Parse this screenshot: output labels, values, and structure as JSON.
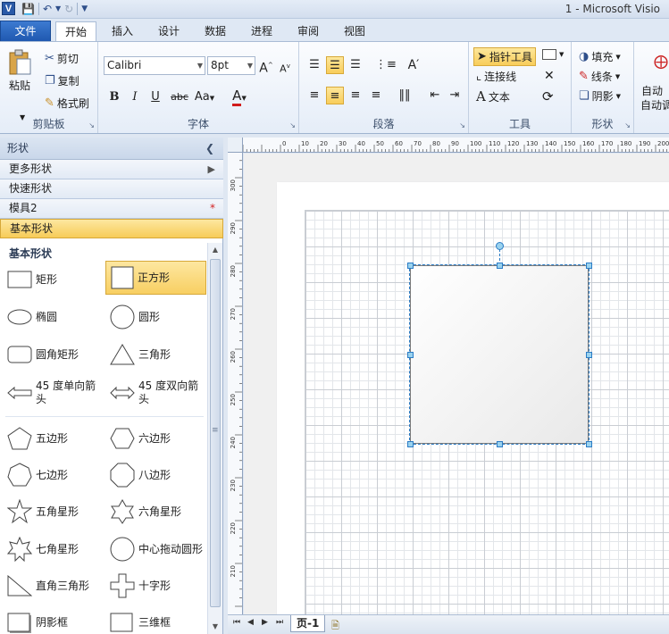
{
  "window": {
    "title": "1  -  Microsoft Visio",
    "app_badge": "V"
  },
  "qat": {
    "save_icon": "floppy-disk-icon",
    "undo_icon": "undo-icon",
    "redo_icon": "redo-icon",
    "customize_icon": "qat-customize-icon"
  },
  "tabs": [
    {
      "label": "文件"
    },
    {
      "label": "开始"
    },
    {
      "label": "插入"
    },
    {
      "label": "设计"
    },
    {
      "label": "数据"
    },
    {
      "label": "进程"
    },
    {
      "label": "审阅"
    },
    {
      "label": "视图"
    }
  ],
  "ribbon": {
    "clipboard": {
      "label": "剪贴板",
      "paste": "粘贴",
      "cut": "剪切",
      "copy": "复制",
      "format_painter": "格式刷"
    },
    "font": {
      "label": "字体",
      "family": "Calibri",
      "size": "8pt",
      "bold": "B",
      "italic": "I",
      "underline": "U",
      "strike": "abc",
      "case": "Aa",
      "color": "A",
      "grow": "A",
      "shrink": "A"
    },
    "paragraph": {
      "label": "段落"
    },
    "tools": {
      "label": "工具",
      "pointer": "指针工具",
      "connector": "连接线",
      "text": "文本",
      "text_glyph": "A"
    },
    "shape": {
      "label": "形状",
      "fill": "填充",
      "line": "线条",
      "shadow": "阴影"
    },
    "extra": {
      "line1": "自动",
      "line2": "自动调"
    }
  },
  "pane": {
    "title": "形状",
    "more_shapes": "更多形状",
    "quick_shapes": "快速形状",
    "stencil": "模具2",
    "stencil_star": "*",
    "basic_shapes_tab": "基本形状",
    "section_title": "基本形状",
    "shapes": [
      {
        "name": "矩形",
        "icon": "rectangle-icon"
      },
      {
        "name": "正方形",
        "icon": "square-icon"
      },
      {
        "name": "椭圆",
        "icon": "ellipse-icon"
      },
      {
        "name": "圆形",
        "icon": "circle-icon"
      },
      {
        "name": "圆角矩形",
        "icon": "rounded-rectangle-icon"
      },
      {
        "name": "三角形",
        "icon": "triangle-icon"
      },
      {
        "name": "45 度单向箭头",
        "icon": "single-arrow-icon"
      },
      {
        "name": "45 度双向箭头",
        "icon": "double-arrow-icon"
      },
      {
        "name": "五边形",
        "icon": "pentagon-icon"
      },
      {
        "name": "六边形",
        "icon": "hexagon-icon"
      },
      {
        "name": "七边形",
        "icon": "heptagon-icon"
      },
      {
        "name": "八边形",
        "icon": "octagon-icon"
      },
      {
        "name": "五角星形",
        "icon": "five-point-star-icon"
      },
      {
        "name": "六角星形",
        "icon": "six-point-star-icon"
      },
      {
        "name": "七角星形",
        "icon": "seven-point-star-icon"
      },
      {
        "name": "中心拖动圆形",
        "icon": "center-drag-circle-icon"
      },
      {
        "name": "直角三角形",
        "icon": "right-triangle-icon"
      },
      {
        "name": "十字形",
        "icon": "cross-icon"
      },
      {
        "name": "阴影框",
        "icon": "shadow-box-icon"
      },
      {
        "name": "三维框",
        "icon": "3d-box-icon"
      }
    ]
  },
  "rulers": {
    "horizontal": [
      "0",
      "10",
      "20",
      "30",
      "40",
      "50",
      "60",
      "70",
      "80",
      "90",
      "100",
      "110",
      "120",
      "130",
      "140",
      "150",
      "160",
      "170",
      "180",
      "190",
      "200",
      "210"
    ],
    "vertical": [
      "300",
      "290",
      "280",
      "270",
      "260",
      "250",
      "240",
      "230",
      "220",
      "210"
    ]
  },
  "page_tabs": {
    "current": "页-1"
  }
}
